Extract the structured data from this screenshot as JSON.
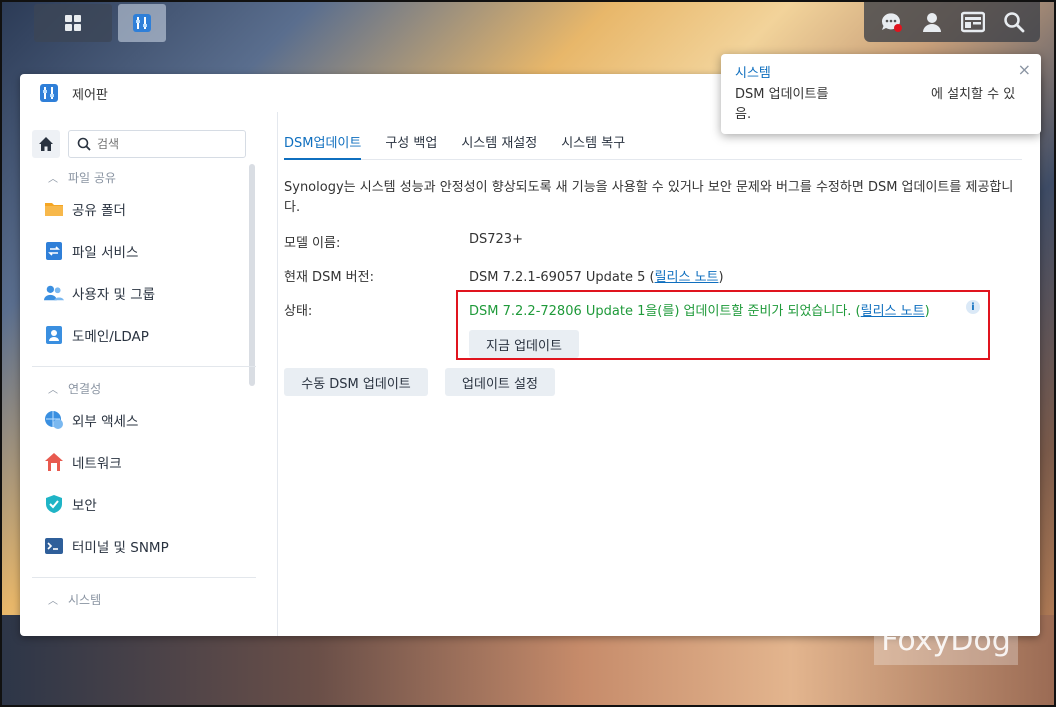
{
  "window": {
    "title": "제어판"
  },
  "sidebar": {
    "search_placeholder": "검색",
    "categories": [
      {
        "label": "파일 공유",
        "items": [
          "공유 폴더",
          "파일 서비스",
          "사용자 및 그룹",
          "도메인/LDAP"
        ]
      },
      {
        "label": "연결성",
        "items": [
          "외부 액세스",
          "네트워크",
          "보안",
          "터미널 및 SNMP"
        ]
      },
      {
        "label": "시스템",
        "items": []
      }
    ]
  },
  "tabs": [
    "DSM업데이트",
    "구성 백업",
    "시스템 재설정",
    "시스템 복구"
  ],
  "main": {
    "description": "Synology는 시스템 성능과 안정성이 향상되도록 새 기능을 사용할 수 있거나 보안 문제와 버그를 수정하면 DSM 업데이트를 제공합니다.",
    "model_label": "모델 이름:",
    "model_value": "DS723+",
    "version_label": "현재 DSM 버전:",
    "version_value": "DSM 7.2.1-69057 Update 5 (",
    "version_link": "릴리스 노트",
    "version_suffix": ")",
    "status_label": "상태:",
    "status_value": "DSM 7.2.2-72806 Update 1을(를) 업데이트할 준비가 되었습니다. (",
    "status_link": "릴리스 노트",
    "status_suffix": ")",
    "info_icon": "i",
    "update_now_label": "지금 업데이트",
    "manual_update_label": "수동 DSM 업데이트",
    "update_settings_label": "업데이트 설정"
  },
  "notification": {
    "title": "시스템",
    "close": "×",
    "body_part1": "DSM 업데이트를",
    "body_part2": "에 설치할 수 있",
    "body_part3": "음."
  },
  "watermark": "FoxyDog",
  "colors": {
    "accent": "#0f6fbf",
    "success": "#1f9a3a",
    "highlight": "#e0141e"
  }
}
